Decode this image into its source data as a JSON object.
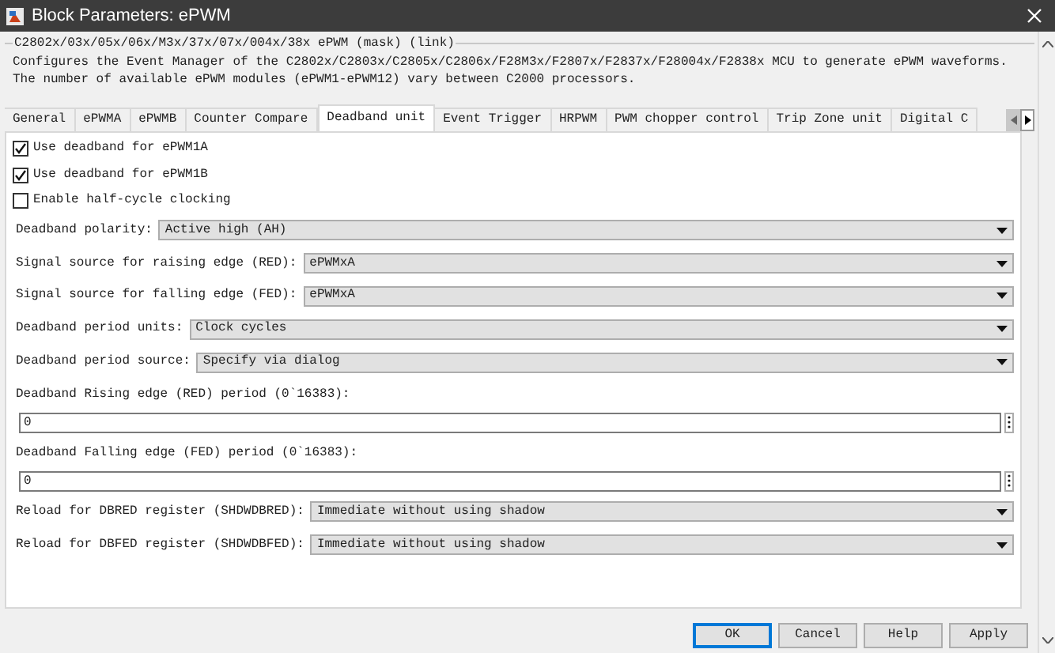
{
  "window": {
    "title": "Block Parameters: ePWM"
  },
  "group": {
    "title": "C2802x/03x/05x/06x/M3x/37x/07x/004x/38x ePWM (mask) (link)",
    "description": [
      "Configures the Event Manager of the C2802x/C2803x/C2805x/C2806x/F28M3x/F2807x/F2837x/F28004x/F2838x MCU to generate ePWM waveforms.",
      "The number of available ePWM modules (ePWM1-ePWM12) vary between C2000 processors."
    ]
  },
  "tabs": [
    {
      "label": "General",
      "selected": false
    },
    {
      "label": "ePWMA",
      "selected": false
    },
    {
      "label": "ePWMB",
      "selected": false
    },
    {
      "label": "Counter Compare",
      "selected": false
    },
    {
      "label": "Deadband unit",
      "selected": true
    },
    {
      "label": "Event Trigger",
      "selected": false
    },
    {
      "label": "HRPWM",
      "selected": false
    },
    {
      "label": "PWM chopper control",
      "selected": false
    },
    {
      "label": "Trip Zone unit",
      "selected": false
    },
    {
      "label": "Digital C",
      "selected": false
    }
  ],
  "parameters": [
    {
      "kind": "checkbox",
      "label": "Use deadband for ePWM1A",
      "checked": true
    },
    {
      "kind": "checkbox",
      "label": "Use deadband for ePWM1B",
      "checked": true
    },
    {
      "kind": "checkbox",
      "label": "Enable half-cycle clocking",
      "checked": false
    },
    {
      "kind": "dropdown",
      "label": "Deadband polarity:",
      "value": "Active high (AH)"
    },
    {
      "kind": "dropdown",
      "label": "Signal source for raising edge (RED):",
      "value": "ePWMxA"
    },
    {
      "kind": "dropdown",
      "label": "Signal source for falling edge (FED):",
      "value": "ePWMxA"
    },
    {
      "kind": "dropdown",
      "label": "Deadband period units:",
      "value": "Clock cycles"
    },
    {
      "kind": "dropdown",
      "label": "Deadband period source:",
      "value": "Specify via dialog"
    },
    {
      "kind": "field",
      "label": "Deadband Rising edge (RED) period (0`16383):",
      "value": "0"
    },
    {
      "kind": "field",
      "label": "Deadband Falling edge (FED) period (0`16383):",
      "value": "0"
    },
    {
      "kind": "dropdown",
      "label": "Reload for DBRED register (SHDWDBRED):",
      "value": "Immediate without using shadow"
    },
    {
      "kind": "dropdown",
      "label": "Reload for DBFED register (SHDWDBFED):",
      "value": "Immediate without using shadow"
    }
  ],
  "buttons": [
    "OK",
    "Cancel",
    "Help",
    "Apply"
  ]
}
